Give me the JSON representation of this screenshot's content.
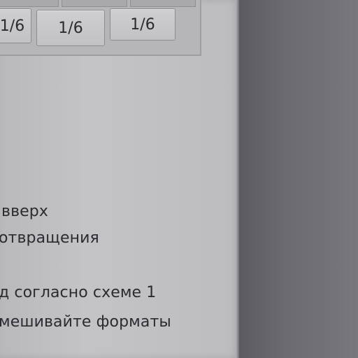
{
  "ratio_cells": [
    "1/6",
    "1/6",
    "1/6"
  ],
  "lines": [
    "вверх",
    "отвращения",
    "д согласно схеме 1",
    "мешивайте форматы"
  ]
}
